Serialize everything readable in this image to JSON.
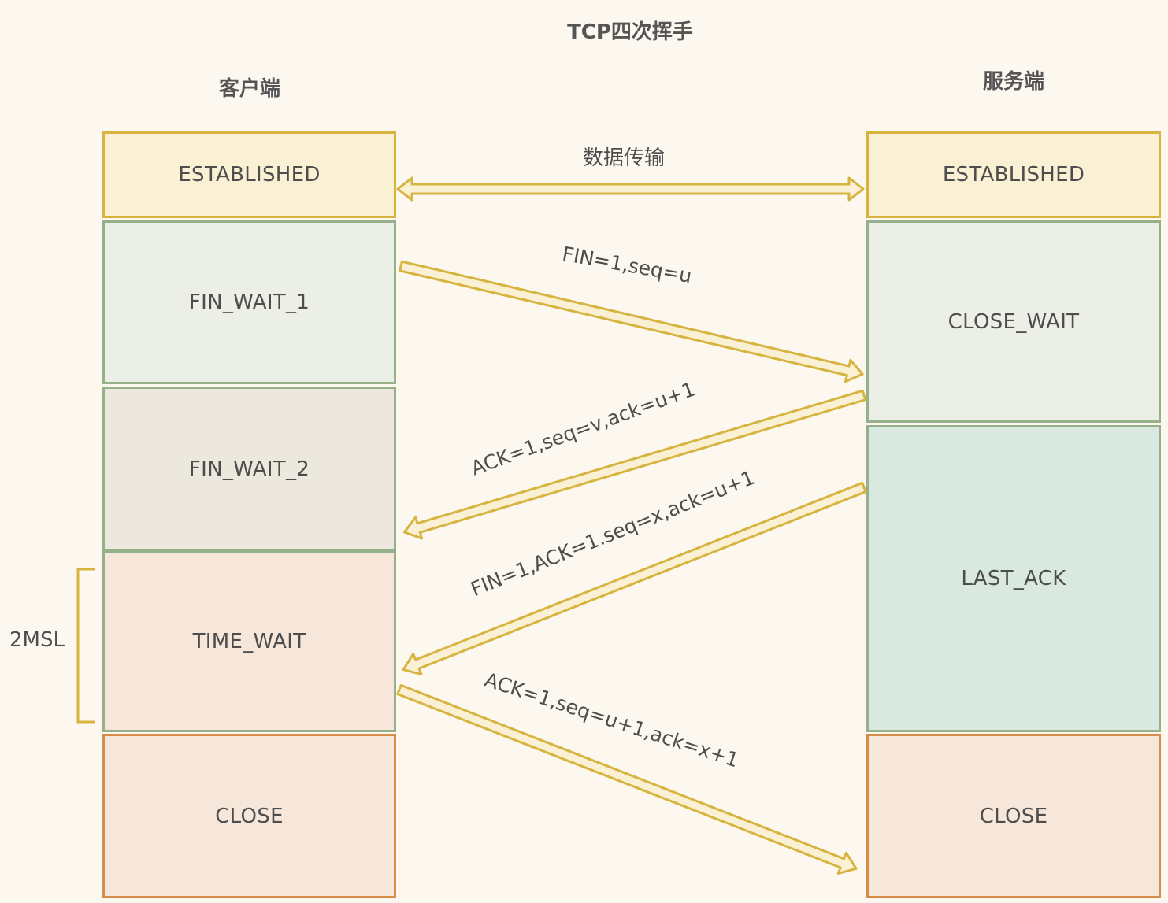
{
  "title": "TCP四次挥手",
  "client": {
    "title": "客户端",
    "states": [
      "ESTABLISHED",
      "FIN_WAIT_1",
      "FIN_WAIT_2",
      "TIME_WAIT",
      "CLOSE"
    ]
  },
  "server": {
    "title": "服务端",
    "states": [
      "ESTABLISHED",
      "CLOSE_WAIT",
      "LAST_ACK",
      "CLOSE"
    ]
  },
  "messages": {
    "data_transfer": "数据传输",
    "m1": "FIN=1,seq=u",
    "m2": "ACK=1,seq=v,ack=u+1",
    "m3": "FIN=1,ACK=1.seq=x,ack=u+1",
    "m4": "ACK=1,seq=u+1,ack=x+1"
  },
  "timer": "2MSL",
  "colors": {
    "arrow_stroke": "#d6b43f",
    "arrow_fill": "#faf0d4",
    "background": "#fcf8ef"
  }
}
